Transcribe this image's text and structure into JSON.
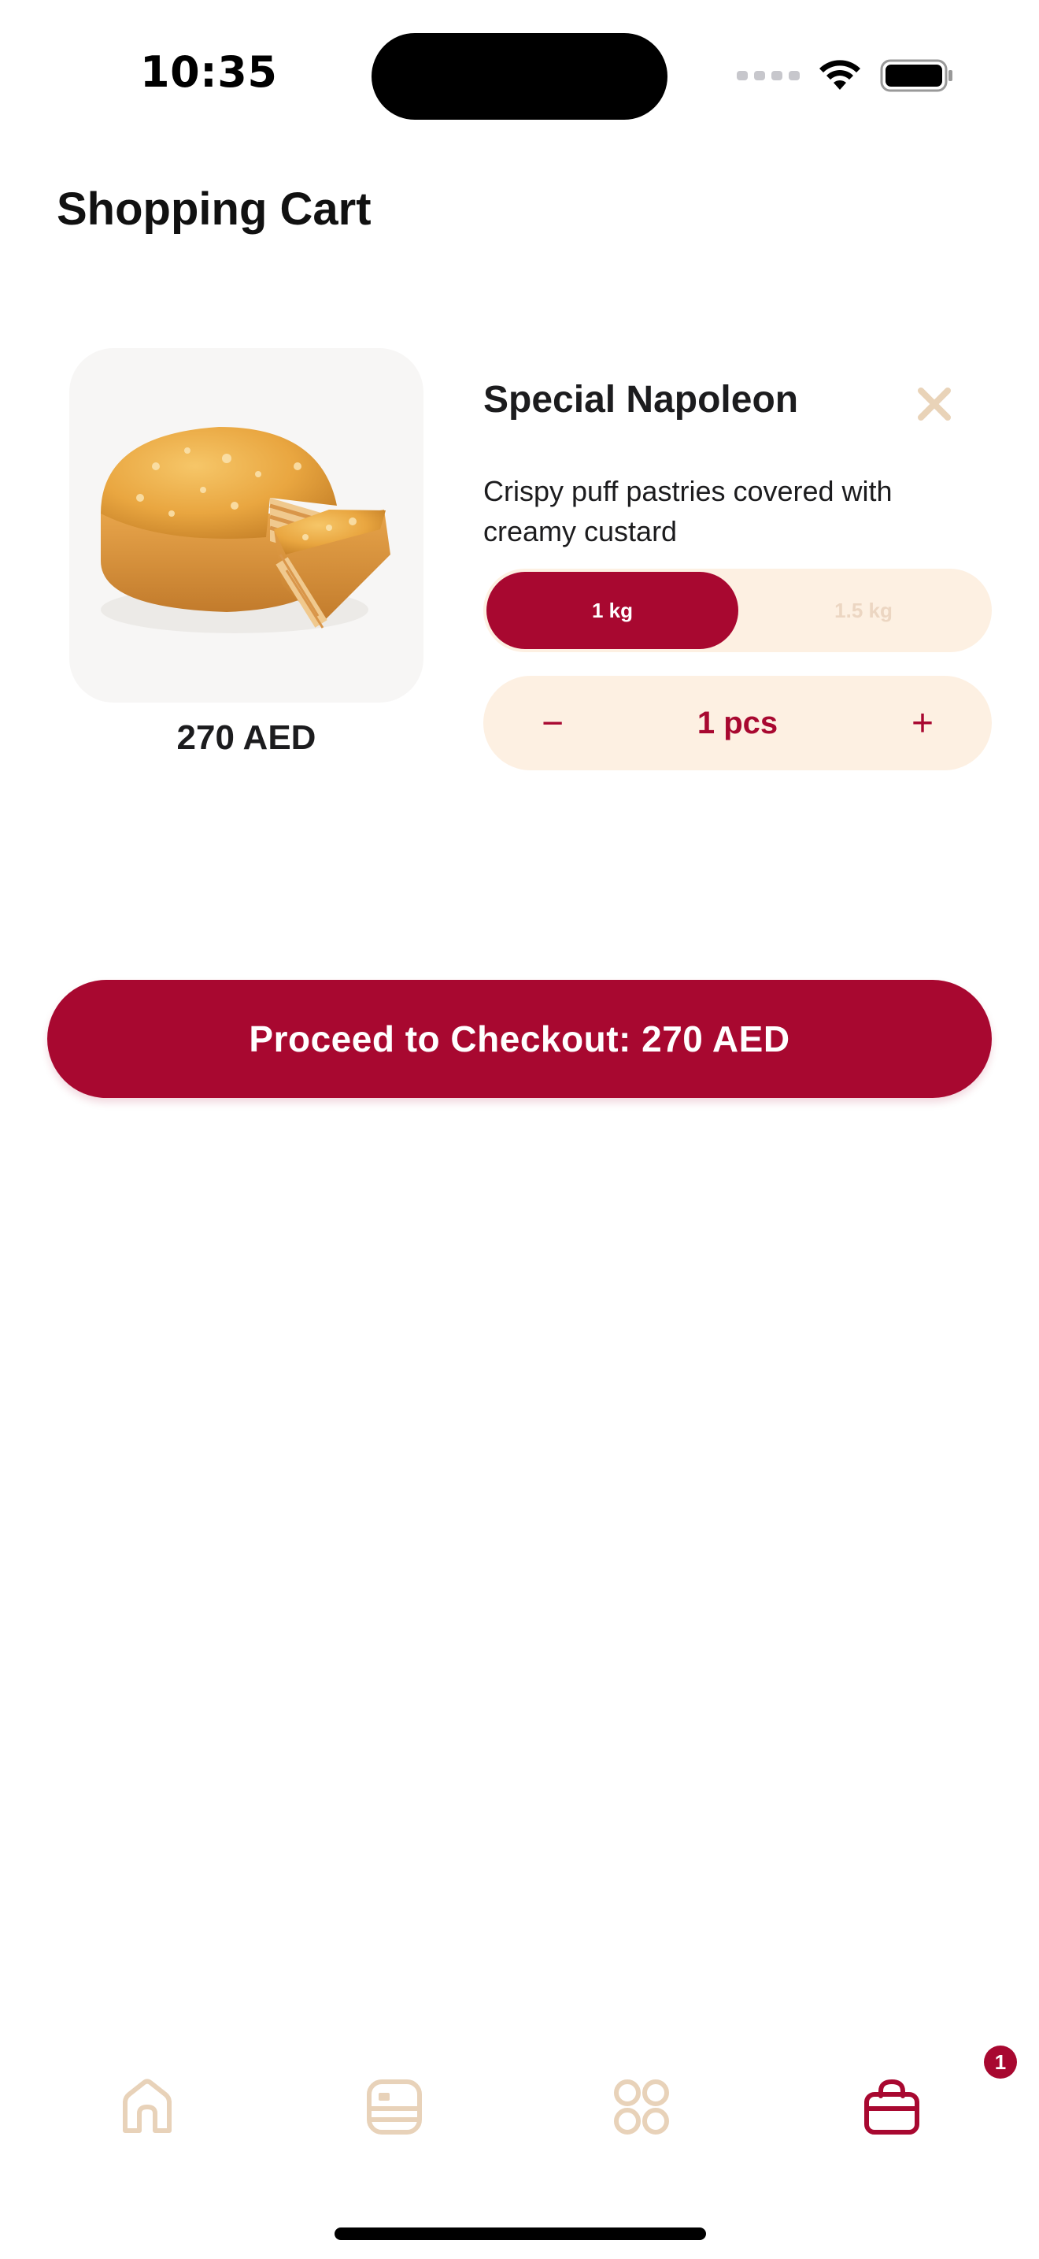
{
  "status_bar": {
    "time": "10:35"
  },
  "header": {
    "title": "Shopping Cart"
  },
  "cart": {
    "items": [
      {
        "name": "Special Napoleon",
        "description": "Crispy puff pastries covered with creamy custard",
        "price": "270 AED",
        "image_icon": "napoleon-cake-image",
        "weight_options": [
          {
            "label": "1 kg",
            "selected": true
          },
          {
            "label": "1.5 kg",
            "selected": false
          }
        ],
        "quantity_display": "1 pcs",
        "decrement_symbol": "−",
        "increment_symbol": "+"
      }
    ]
  },
  "checkout": {
    "label": "Proceed to Checkout: 270 AED"
  },
  "tab_bar": {
    "tabs": [
      {
        "icon": "home-icon",
        "active": false
      },
      {
        "icon": "menu-card-icon",
        "active": false
      },
      {
        "icon": "categories-icon",
        "active": false
      },
      {
        "icon": "shopping-bag-icon",
        "active": true
      }
    ],
    "cart_badge": "1"
  },
  "colors": {
    "brand": "#a80830",
    "soft_cream": "#fdf0e2",
    "inactive_icon": "#e8d2b9"
  }
}
